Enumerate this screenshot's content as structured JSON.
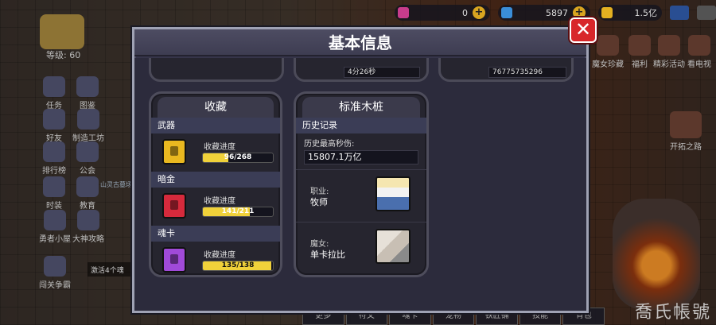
{
  "modal": {
    "title": "基本信息",
    "close_label": "✕",
    "top_peek": {
      "time": "4分26秒",
      "number": "76775735296"
    },
    "collection": {
      "title": "收藏",
      "sections": [
        {
          "name": "武器",
          "progress_label": "收藏进度",
          "current": 96,
          "total": 268,
          "progress_text": "96/268",
          "icon_color": "#e9b820"
        },
        {
          "name": "暗金",
          "progress_label": "收藏进度",
          "current": 141,
          "total": 211,
          "progress_text": "141/211",
          "icon_color": "#d62a3c"
        },
        {
          "name": "魂卡",
          "progress_label": "收藏进度",
          "current": 135,
          "total": 138,
          "progress_text": "135/138",
          "icon_color": "#a04ad8"
        }
      ]
    },
    "dummy": {
      "title": "标准木桩",
      "history_label": "历史记录",
      "max_dps_label": "历史最高秒伤:",
      "max_dps_value": "15807.1万亿",
      "class_label": "职业:",
      "class_value": "牧师",
      "witch_label": "魔女:",
      "witch_value": "单卡拉比"
    }
  },
  "hud": {
    "level": "等级: 60",
    "resources": [
      {
        "value": "0",
        "color": "#c83c8c",
        "icon": "gem-icon"
      },
      {
        "value": "5897",
        "color": "#3a8ed8",
        "icon": "diamond-icon"
      },
      {
        "value": "1.5亿",
        "color": "#e3b021",
        "icon": "coin-icon"
      }
    ],
    "left_buttons": [
      "任务",
      "图鉴",
      "好友",
      "制造工坊",
      "排行榜",
      "公会",
      "时装",
      "教育",
      "勇者小屋",
      "大神攻略",
      "闯关争霸"
    ],
    "right_buttons": [
      "魔女珍藏",
      "福利",
      "精彩活动",
      "看电视",
      "开拓之路"
    ],
    "quest_text": "激活4个魂",
    "dungeon_label": "山灵古墓场",
    "bottom_tabs": [
      "更多",
      "符文",
      "魂卡",
      "宠物",
      "铁匠铺",
      "技能",
      "背包"
    ],
    "watermark": "喬氏帳號"
  }
}
